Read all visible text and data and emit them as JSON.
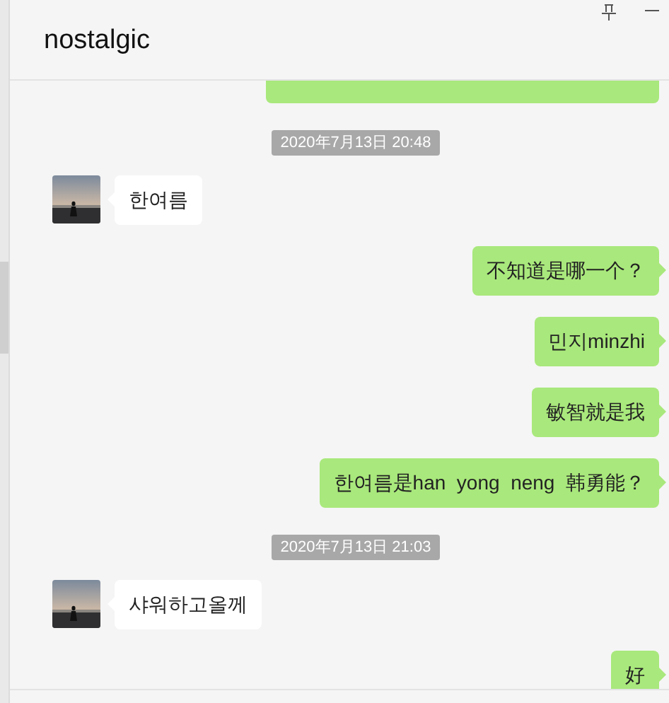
{
  "window": {
    "title": "nostalgic"
  },
  "messages": [
    {
      "kind": "outgoing_cut"
    },
    {
      "kind": "time",
      "text": "2020年7月13日 20:48"
    },
    {
      "kind": "incoming",
      "text": "한여름"
    },
    {
      "kind": "outgoing",
      "text": "不知道是哪一个？"
    },
    {
      "kind": "outgoing",
      "text": "민지minzhi"
    },
    {
      "kind": "outgoing",
      "text": "敏智就是我"
    },
    {
      "kind": "outgoing",
      "text": "한여름是han  yong  neng  韩勇能？"
    },
    {
      "kind": "time",
      "text": "2020年7月13日 21:03"
    },
    {
      "kind": "incoming",
      "text": "샤워하고올께"
    },
    {
      "kind": "outgoing",
      "text": "好"
    }
  ]
}
